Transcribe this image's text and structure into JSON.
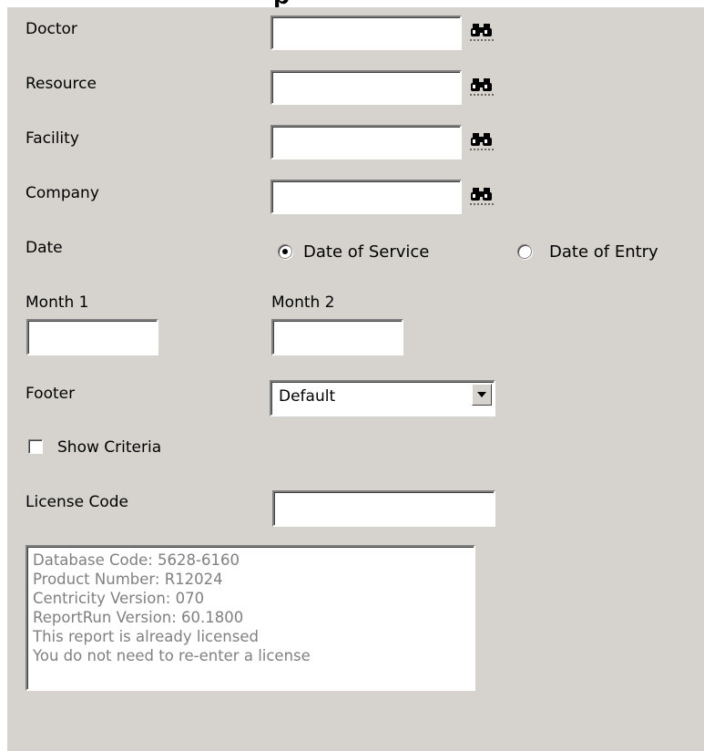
{
  "form": {
    "doctor_label": "Doctor",
    "resource_label": "Resource",
    "facility_label": "Facility",
    "company_label": "Company",
    "date_label": "Date",
    "date_options": [
      "Date of Service",
      "Date of Entry"
    ],
    "date_selected": "Date of Service",
    "month1_label": "Month 1",
    "month2_label": "Month 2",
    "footer_label": "Footer",
    "footer_value": "Default",
    "show_criteria_label": "Show Criteria",
    "show_criteria_checked": false,
    "license_label": "License Code",
    "lookup_icon": "binoculars-icon"
  },
  "info_lines": [
    "Database Code: 5628-6160",
    "Product Number: R12024",
    "Centricity Version: 070",
    "ReportRun Version: 60.1800",
    "This report is already licensed",
    "You do not need to re-enter a license"
  ]
}
